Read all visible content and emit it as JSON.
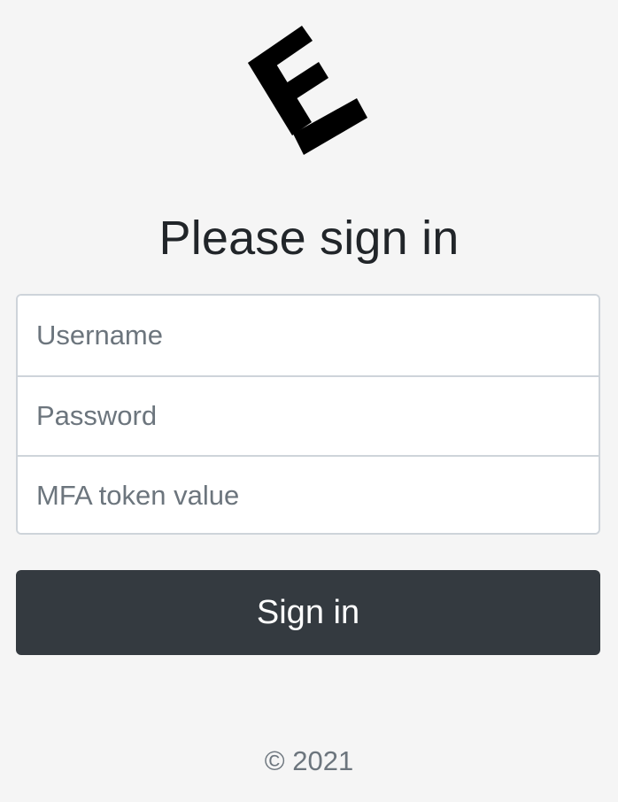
{
  "logo": {
    "icon": "brand-logo-icon",
    "color": "#000000"
  },
  "heading": {
    "title": "Please sign in"
  },
  "form": {
    "username": {
      "placeholder": "Username",
      "value": ""
    },
    "password": {
      "placeholder": "Password",
      "value": ""
    },
    "mfa": {
      "placeholder": "MFA token value",
      "value": ""
    },
    "submit_label": "Sign in"
  },
  "footer": {
    "copyright": "© 2021"
  },
  "colors": {
    "background": "#f5f5f5",
    "button": "#343a40",
    "button_text": "#ffffff",
    "heading_text": "#212529",
    "placeholder_text": "#6c757d",
    "input_border": "#ced4da"
  }
}
